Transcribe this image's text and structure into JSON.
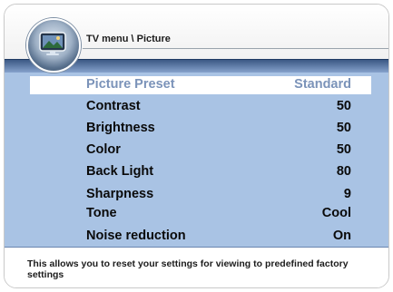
{
  "header": {
    "title": "TV menu \\ Picture"
  },
  "menu": {
    "items": [
      {
        "label": "Picture Preset",
        "value": "Standard"
      },
      {
        "label": "Contrast",
        "value": "50"
      },
      {
        "label": "Brightness",
        "value": "50"
      },
      {
        "label": "Color",
        "value": "50"
      },
      {
        "label": "Back Light",
        "value": "80"
      },
      {
        "label": "Sharpness",
        "value": "9"
      },
      {
        "label": "Tone",
        "value": "Cool"
      },
      {
        "label": "Noise reduction",
        "value": "On"
      }
    ]
  },
  "footer": {
    "help_text": "This allows you to reset your settings for viewing to predefined factory settings"
  },
  "colors": {
    "panel": "#a9c3e4",
    "selected_text": "#7b93b9"
  },
  "icons": [
    "tv-picture-icon"
  ]
}
